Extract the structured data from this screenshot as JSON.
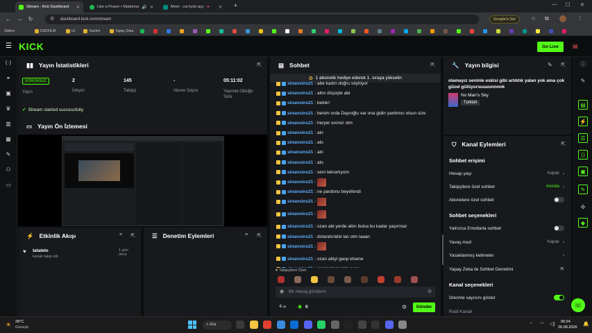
{
  "browser": {
    "tabs": [
      {
        "title": "Stream - Kick Dashboard",
        "active": true,
        "color": "#53fc18"
      },
      {
        "title": "Like a Prayer • Madonna",
        "active": false,
        "color": "#1db954"
      },
      {
        "title": "Meet - cui-hydc-qyc",
        "active": false,
        "color": "#00897b"
      }
    ],
    "url": "dashboard.kick.com/stream",
    "google_label": "Google'a Sor",
    "bookmarks": [
      "Sliders",
      "DIZI/FILM",
      "UI",
      "Yazılım",
      "Yapay Zeka"
    ]
  },
  "app": {
    "logo": "KICK",
    "go_live": "Go Live"
  },
  "stats": {
    "title": "Yayın İstatistikleri",
    "status_badge": "SORUNSUZ",
    "status_label": "Yayın",
    "viewers_value": "2",
    "viewers_label": "İzleyici",
    "followers_value": "145",
    "followers_label": "Takipçi",
    "subs_value": "-",
    "subs_label": "Abone Sayısı",
    "uptime_value": "05:11:02",
    "uptime_label": "Yayında Olduğu Süre",
    "notice": "Stream started successfully."
  },
  "preview": {
    "title": "Yayın Ön İzlemesi"
  },
  "activity": {
    "title": "Etkinlik Akışı",
    "items": [
      {
        "user": "talatelo",
        "text": "kanalı takip etti",
        "time": "1 gün önce"
      }
    ]
  },
  "moderation": {
    "title": "Denetim Eylemleri"
  },
  "chat": {
    "title": "Sohbet",
    "pinned": "1 abonelik hediye ederek 1. sıraya yükselin",
    "messages": [
      {
        "user": "sinansins21",
        "text": "abe kadın doğru söylüyor"
      },
      {
        "user": "sinansins21",
        "text": "altın düşüşte abi"
      },
      {
        "user": "sinansins21",
        "text": "bekleт"
      },
      {
        "user": "sinansins21",
        "text": "benim orda Dayıoğlu var ona gidin yardımcı olsun size"
      },
      {
        "user": "sinansins21",
        "text": "heryer evimiz olm"
      },
      {
        "user": "sinansins21",
        "text": "alo"
      },
      {
        "user": "sinansins21",
        "text": "alo"
      },
      {
        "user": "sinansins21",
        "text": "alo"
      },
      {
        "user": "sinansins21",
        "text": "alo"
      },
      {
        "user": "sinansins21",
        "text": "seni tekrarlıyom"
      },
      {
        "user": "sinansins21",
        "text": ""
      },
      {
        "user": "sinansins21",
        "text": "ne pardonu beyefendi"
      },
      {
        "user": "sinansins21",
        "text": ""
      },
      {
        "user": "sinansins21",
        "text": ""
      },
      {
        "user": "sinansins21",
        "text": "ozan abi yerde altın bulsa bu kadar şaşırmaz"
      },
      {
        "user": "sinansins21",
        "text": "dolandırıldık lan olm laaan"
      },
      {
        "user": "sinansins21",
        "text": ""
      },
      {
        "user": "sinansins21",
        "text": "ozan abiyi gasp etsene"
      },
      {
        "user": "sinansins21",
        "text": "gereksiz zengin şuan"
      }
    ],
    "followers_only": "Takipçilere Özel",
    "input_placeholder": "Bir mesaj gönderin",
    "count": "0",
    "send": "Gönder"
  },
  "stream_info": {
    "title": "Yayın bilgisi",
    "stream_title": "olamayız seninle eskisi gibi artıktık yalan yok ama çok güzel gülüyorsuuuunnnnk",
    "game": "No Man's Sky",
    "language": "Turkish"
  },
  "channel_actions": {
    "title": "Kanal Eylemleri",
    "access_title": "Sohbet erişimi",
    "account_age": "Hesap yaşı",
    "account_age_value": "Kapalı",
    "followers_chat": "Takipçilere özel sohbet",
    "followers_chat_value": "Anında",
    "subs_chat": "Abonelere özel sohbet",
    "chat_options_title": "Sohbet seçenekleri",
    "emotes_only": "Yalnızca Emotlarla sohbet",
    "slow_mode": "Yavaş mod",
    "slow_mode_value": "Kapalı",
    "banned_words": "Yasaklanmış kelimeler",
    "ai_moderation": "Yapay Zeka ile Sohbet Denetimi",
    "channel_options_title": "Kanal seçenekleri",
    "show_viewers": "İzlenme sayısını göster",
    "raid": "Raid Kanalı"
  },
  "taskbar": {
    "temp": "28°C",
    "weather": "Güneşli",
    "search": "Ara",
    "time": "00:24",
    "date": "26.08.2026"
  }
}
